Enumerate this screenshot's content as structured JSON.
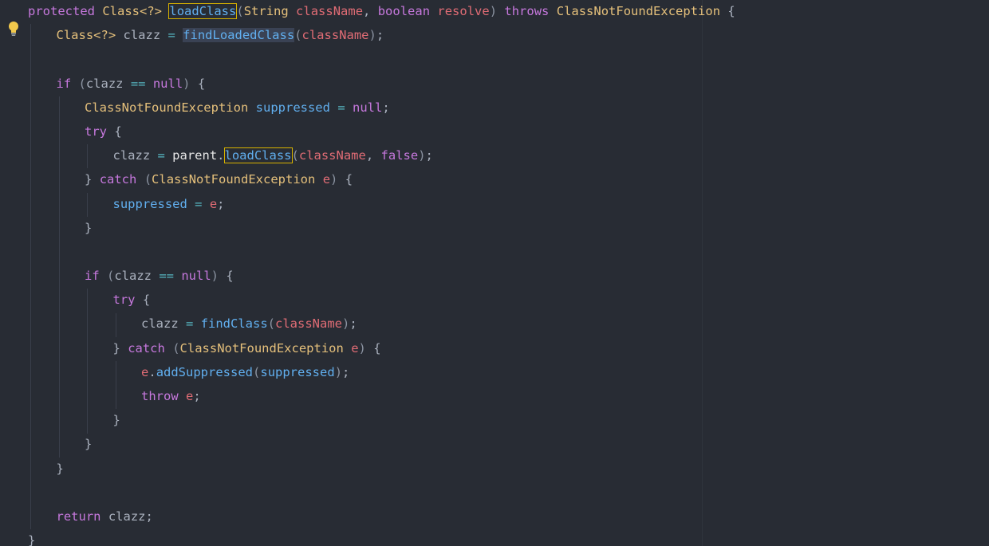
{
  "editor": {
    "gutter_icon": "lightbulb-icon",
    "colors": {
      "background": "#282c34",
      "keyword": "#c678dd",
      "type": "#e5c07b",
      "function": "#61afef",
      "parameter": "#e06c75",
      "highlight_box": "#d7b200"
    },
    "lines": [
      {
        "indent": 0,
        "tokens": [
          {
            "t": "protected",
            "c": "kw"
          },
          {
            "t": " ",
            "c": "plain"
          },
          {
            "t": "Class",
            "c": "type"
          },
          {
            "t": "<?>",
            "c": "type"
          },
          {
            "t": " ",
            "c": "plain"
          },
          {
            "t": "loadClass",
            "c": "fn",
            "box": true
          },
          {
            "t": "(",
            "c": "paren"
          },
          {
            "t": "String",
            "c": "type"
          },
          {
            "t": " ",
            "c": "plain"
          },
          {
            "t": "className",
            "c": "var"
          },
          {
            "t": ", ",
            "c": "punct"
          },
          {
            "t": "boolean",
            "c": "kw"
          },
          {
            "t": " ",
            "c": "plain"
          },
          {
            "t": "resolve",
            "c": "var"
          },
          {
            "t": ") ",
            "c": "paren"
          },
          {
            "t": "throws",
            "c": "kw"
          },
          {
            "t": " ",
            "c": "plain"
          },
          {
            "t": "ClassNotFoundException",
            "c": "type"
          },
          {
            "t": " {",
            "c": "punct"
          }
        ]
      },
      {
        "indent": 1,
        "tokens": [
          {
            "t": "Class<?>",
            "c": "type"
          },
          {
            "t": " ",
            "c": "plain"
          },
          {
            "t": "clazz",
            "c": "id"
          },
          {
            "t": " = ",
            "c": "op"
          },
          {
            "t": "findLoadedClass",
            "c": "fn",
            "bg": true
          },
          {
            "t": "(",
            "c": "paren"
          },
          {
            "t": "className",
            "c": "var"
          },
          {
            "t": ")",
            "c": "paren"
          },
          {
            "t": ";",
            "c": "punct"
          }
        ]
      },
      {
        "indent": 0,
        "tokens": []
      },
      {
        "indent": 1,
        "tokens": [
          {
            "t": "if",
            "c": "kw"
          },
          {
            "t": " (",
            "c": "paren"
          },
          {
            "t": "clazz",
            "c": "id"
          },
          {
            "t": " == ",
            "c": "op"
          },
          {
            "t": "null",
            "c": "kw"
          },
          {
            "t": ")",
            "c": "paren"
          },
          {
            "t": " {",
            "c": "punct"
          }
        ]
      },
      {
        "indent": 2,
        "tokens": [
          {
            "t": "ClassNotFoundException",
            "c": "type"
          },
          {
            "t": " ",
            "c": "plain"
          },
          {
            "t": "suppressed",
            "c": "fn"
          },
          {
            "t": " = ",
            "c": "op"
          },
          {
            "t": "null",
            "c": "kw"
          },
          {
            "t": ";",
            "c": "punct"
          }
        ]
      },
      {
        "indent": 2,
        "tokens": [
          {
            "t": "try",
            "c": "kw"
          },
          {
            "t": " {",
            "c": "punct"
          }
        ]
      },
      {
        "indent": 3,
        "tokens": [
          {
            "t": "clazz",
            "c": "id"
          },
          {
            "t": " = ",
            "c": "op"
          },
          {
            "t": "parent",
            "c": "bright"
          },
          {
            "t": ".",
            "c": "punct"
          },
          {
            "t": "loadClass",
            "c": "fn",
            "box": true
          },
          {
            "t": "(",
            "c": "paren"
          },
          {
            "t": "className",
            "c": "var"
          },
          {
            "t": ", ",
            "c": "punct"
          },
          {
            "t": "false",
            "c": "kw"
          },
          {
            "t": ")",
            "c": "paren"
          },
          {
            "t": ";",
            "c": "punct"
          }
        ]
      },
      {
        "indent": 2,
        "tokens": [
          {
            "t": "}",
            "c": "punct"
          },
          {
            "t": " ",
            "c": "plain"
          },
          {
            "t": "catch",
            "c": "kw"
          },
          {
            "t": " (",
            "c": "paren"
          },
          {
            "t": "ClassNotFoundException",
            "c": "type"
          },
          {
            "t": " ",
            "c": "plain"
          },
          {
            "t": "e",
            "c": "var"
          },
          {
            "t": ")",
            "c": "paren"
          },
          {
            "t": " {",
            "c": "punct"
          }
        ]
      },
      {
        "indent": 3,
        "tokens": [
          {
            "t": "suppressed",
            "c": "fn"
          },
          {
            "t": " = ",
            "c": "op"
          },
          {
            "t": "e",
            "c": "var"
          },
          {
            "t": ";",
            "c": "punct"
          }
        ]
      },
      {
        "indent": 2,
        "tokens": [
          {
            "t": "}",
            "c": "punct"
          }
        ]
      },
      {
        "indent": 0,
        "tokens": []
      },
      {
        "indent": 2,
        "tokens": [
          {
            "t": "if",
            "c": "kw"
          },
          {
            "t": " (",
            "c": "paren"
          },
          {
            "t": "clazz",
            "c": "id"
          },
          {
            "t": " == ",
            "c": "op"
          },
          {
            "t": "null",
            "c": "kw"
          },
          {
            "t": ")",
            "c": "paren"
          },
          {
            "t": " {",
            "c": "punct"
          }
        ]
      },
      {
        "indent": 3,
        "tokens": [
          {
            "t": "try",
            "c": "kw"
          },
          {
            "t": " {",
            "c": "punct"
          }
        ]
      },
      {
        "indent": 4,
        "tokens": [
          {
            "t": "clazz",
            "c": "id"
          },
          {
            "t": " = ",
            "c": "op"
          },
          {
            "t": "findClass",
            "c": "fn"
          },
          {
            "t": "(",
            "c": "paren"
          },
          {
            "t": "className",
            "c": "var"
          },
          {
            "t": ")",
            "c": "paren"
          },
          {
            "t": ";",
            "c": "punct"
          }
        ]
      },
      {
        "indent": 3,
        "tokens": [
          {
            "t": "}",
            "c": "punct"
          },
          {
            "t": " ",
            "c": "plain"
          },
          {
            "t": "catch",
            "c": "kw"
          },
          {
            "t": " (",
            "c": "paren"
          },
          {
            "t": "ClassNotFoundException",
            "c": "type"
          },
          {
            "t": " ",
            "c": "plain"
          },
          {
            "t": "e",
            "c": "var"
          },
          {
            "t": ")",
            "c": "paren"
          },
          {
            "t": " {",
            "c": "punct"
          }
        ]
      },
      {
        "indent": 4,
        "tokens": [
          {
            "t": "e",
            "c": "var"
          },
          {
            "t": ".",
            "c": "punct"
          },
          {
            "t": "addSuppressed",
            "c": "fn"
          },
          {
            "t": "(",
            "c": "paren"
          },
          {
            "t": "suppressed",
            "c": "fn"
          },
          {
            "t": ")",
            "c": "paren"
          },
          {
            "t": ";",
            "c": "punct"
          }
        ]
      },
      {
        "indent": 4,
        "tokens": [
          {
            "t": "throw",
            "c": "kw"
          },
          {
            "t": " ",
            "c": "plain"
          },
          {
            "t": "e",
            "c": "var"
          },
          {
            "t": ";",
            "c": "punct"
          }
        ]
      },
      {
        "indent": 3,
        "tokens": [
          {
            "t": "}",
            "c": "punct"
          }
        ]
      },
      {
        "indent": 2,
        "tokens": [
          {
            "t": "}",
            "c": "punct"
          }
        ]
      },
      {
        "indent": 1,
        "tokens": [
          {
            "t": "}",
            "c": "punct"
          }
        ]
      },
      {
        "indent": 0,
        "tokens": []
      },
      {
        "indent": 1,
        "tokens": [
          {
            "t": "return",
            "c": "kw"
          },
          {
            "t": " ",
            "c": "plain"
          },
          {
            "t": "clazz",
            "c": "id"
          },
          {
            "t": ";",
            "c": "punct"
          }
        ]
      },
      {
        "indent": 0,
        "tokens": [
          {
            "t": "}",
            "c": "punct"
          }
        ]
      }
    ]
  }
}
